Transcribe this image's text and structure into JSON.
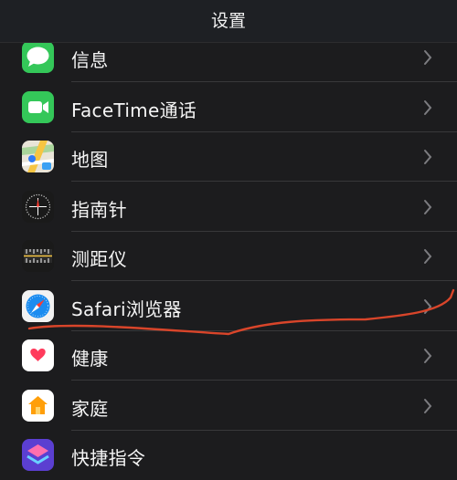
{
  "header": {
    "title": "设置"
  },
  "settings": {
    "items": [
      {
        "label": "信息",
        "icon": "messages-icon"
      },
      {
        "label": "FaceTime通话",
        "icon": "facetime-icon"
      },
      {
        "label": "地图",
        "icon": "maps-icon"
      },
      {
        "label": "指南针",
        "icon": "compass-icon"
      },
      {
        "label": "测距仪",
        "icon": "measure-icon"
      },
      {
        "label": "Safari浏览器",
        "icon": "safari-icon"
      },
      {
        "label": "健康",
        "icon": "health-icon"
      },
      {
        "label": "家庭",
        "icon": "home-icon"
      },
      {
        "label": "快捷指令",
        "icon": "shortcuts-icon"
      }
    ]
  },
  "colors": {
    "background": "#1c1c1e",
    "separator": "#38383a",
    "annotation_stroke": "#d9452a"
  }
}
